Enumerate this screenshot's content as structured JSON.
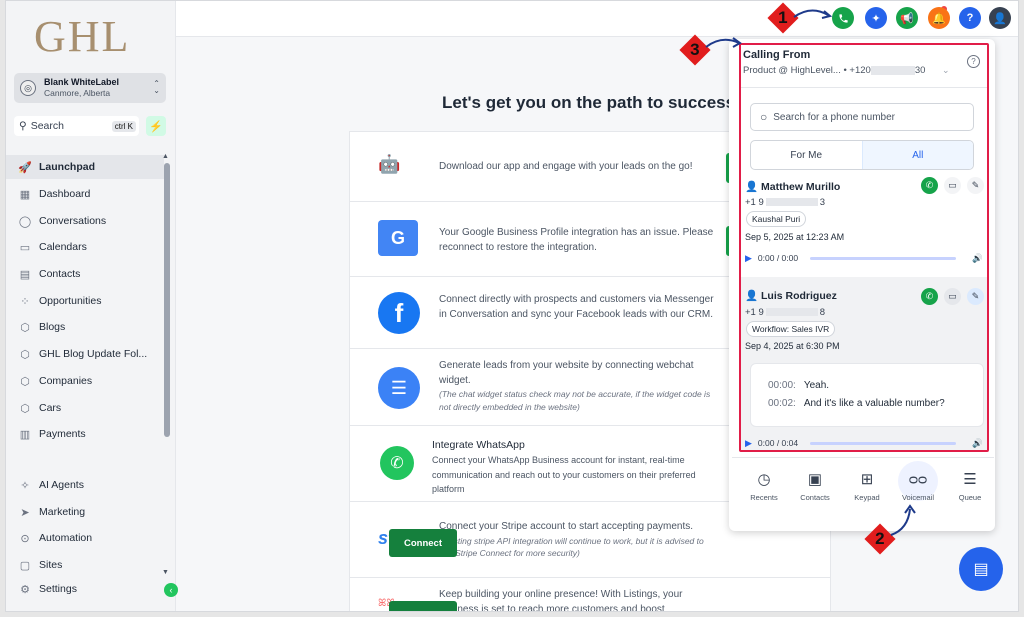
{
  "brand": {
    "logo_text": "GHL"
  },
  "account": {
    "name": "Blank WhiteLabel",
    "location": "Canmore, Alberta"
  },
  "search": {
    "label": "Search",
    "shortcut": "ctrl K"
  },
  "nav": [
    {
      "label": "Launchpad",
      "icon": "launchpad-icon",
      "active": true
    },
    {
      "label": "Dashboard",
      "icon": "dashboard-icon"
    },
    {
      "label": "Conversations",
      "icon": "conversations-icon"
    },
    {
      "label": "Calendars",
      "icon": "calendar-icon"
    },
    {
      "label": "Contacts",
      "icon": "contacts-icon"
    },
    {
      "label": "Opportunities",
      "icon": "opportunities-icon"
    },
    {
      "label": "Blogs",
      "icon": "blogs-icon"
    },
    {
      "label": "GHL Blog Update Fol...",
      "icon": "cube-icon"
    },
    {
      "label": "Companies",
      "icon": "cube-icon"
    },
    {
      "label": "Cars",
      "icon": "cube-icon"
    },
    {
      "label": "Payments",
      "icon": "payments-icon"
    },
    {
      "label": "AI Agents",
      "icon": "ai-agents-icon"
    },
    {
      "label": "Marketing",
      "icon": "marketing-icon"
    },
    {
      "label": "Automation",
      "icon": "automation-icon"
    },
    {
      "label": "Sites",
      "icon": "sites-icon"
    },
    {
      "label": "Settings",
      "icon": "settings-icon"
    }
  ],
  "main": {
    "heading": "Let's get you on the path to success",
    "cards": [
      {
        "text": "Download our app and engage with your leads on the go!",
        "logo": "apple-android-icon"
      },
      {
        "text": "Your Google Business Profile integration has an issue. Please reconnect to restore the integration.",
        "logo": "google-business-icon"
      },
      {
        "text": "Connect directly with prospects and customers via Messenger in Conversation and sync your Facebook leads with our CRM.",
        "logo": "facebook-icon"
      },
      {
        "text": "Generate leads from your website by connecting webchat widget.",
        "note": "(The chat widget status check may not be accurate, if the widget code is not directly embedded in the website)",
        "logo": "webchat-icon"
      },
      {
        "title": "Integrate WhatsApp",
        "text": "Connect your WhatsApp Business account for instant, real-time communication and reach out to your customers on their preferred platform",
        "logo": "whatsapp-icon"
      },
      {
        "text": "Connect your Stripe account to start accepting payments.",
        "note": "(Existing stripe API integration will continue to work, but it is advised to use Stripe Connect for more security)",
        "logo": "stripe",
        "button": "Connect"
      },
      {
        "text": "Keep building your online presence! With Listings, your business is set to reach more customers and boost",
        "logo": "listings-icon"
      }
    ]
  },
  "dialer": {
    "title": "Calling From",
    "from_prefix": "Product @ HighLevel... • +120",
    "from_suffix": "30",
    "search_placeholder": "Search for a phone number",
    "tabs": [
      "For Me",
      "All"
    ],
    "active_tab": "All",
    "calls": [
      {
        "name": "Matthew Murillo",
        "num_prefix": "+1 9",
        "num_suffix": "3",
        "tag": "Kaushal Puri",
        "date": "Sep 5, 2025 at 12:23 AM",
        "time": "0:00 / 0:00"
      },
      {
        "name": "Luis Rodriguez",
        "num_prefix": "+1 9",
        "num_suffix": "8",
        "tag": "Workflow: Sales IVR",
        "date": "Sep 4, 2025 at 6:30 PM",
        "time": "0:00 / 0:04",
        "transcript": [
          {
            "t": "00:00:",
            "text": "Yeah."
          },
          {
            "t": "00:02:",
            "text": "And it's like a valuable number?"
          }
        ]
      }
    ],
    "bottom_tabs": [
      {
        "label": "Recents",
        "icon": "clock-icon"
      },
      {
        "label": "Contacts",
        "icon": "contact-card-icon"
      },
      {
        "label": "Keypad",
        "icon": "keypad-icon"
      },
      {
        "label": "Voicemail",
        "icon": "voicemail-icon",
        "active": true
      },
      {
        "label": "Queue",
        "icon": "queue-icon"
      }
    ]
  },
  "annotations": [
    "1",
    "2",
    "3"
  ],
  "colors": {
    "accent": "#2563eb",
    "green": "#16a34a",
    "highlight": "#e11d48",
    "logo": "#a78f6f"
  }
}
